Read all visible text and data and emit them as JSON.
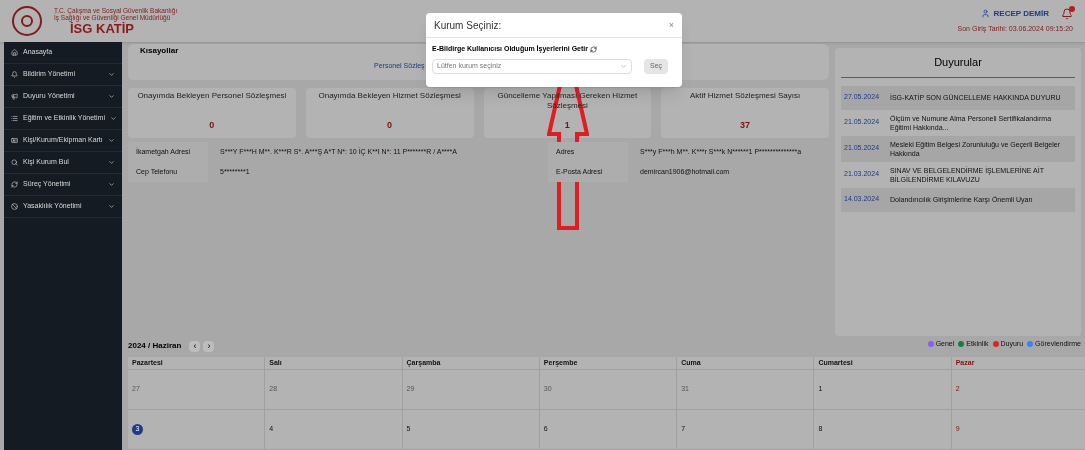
{
  "header": {
    "ministry_lines": [
      "T.C. Çalışma ve Sosyal Güvenlik Bakanlığı",
      "İş Sağlığı ve Güvenliği Genel Müdürlüğü"
    ],
    "brand": "İSG KATİP",
    "user": "RECEP DEMİR",
    "last_login": "Son Giriş Tarihi: 03.06.2024 09:15:20"
  },
  "sidebar": {
    "items": [
      {
        "label": "Anasayfa",
        "has_submenu": false
      },
      {
        "label": "Bildirim Yönetimi",
        "has_submenu": true
      },
      {
        "label": "Duyuru Yönetimi",
        "has_submenu": true
      },
      {
        "label": "Eğitim ve Etkinlik Yönetimi",
        "has_submenu": true
      },
      {
        "label": "Kişi/Kurum/Ekipman Kartı",
        "has_submenu": true
      },
      {
        "label": "Kişi Kurum Bul",
        "has_submenu": true
      },
      {
        "label": "Süreç Yönetimi",
        "has_submenu": true
      },
      {
        "label": "Yasaklılık Yönetimi",
        "has_submenu": true
      }
    ]
  },
  "shortcuts": {
    "title": "Kısayollar",
    "link": "Personel Sözleş"
  },
  "stats": [
    {
      "title": "Onayımda Bekleyen Personel Sözleşmesi",
      "value": "0"
    },
    {
      "title": "Onayımda Bekleyen Hizmet Sözleşmesi",
      "value": "0"
    },
    {
      "title": "Güncelleme Yapılması Gereken Hizmet Sözleşmesi",
      "value": "1"
    },
    {
      "title": "Aktif Hizmet Sözleşmesi Sayısı",
      "value": "37"
    }
  ],
  "profile": {
    "left": [
      {
        "label": "İkametgah Adresi",
        "value": "S***Y F***H M**. K***R S*. A***Ş A*T N*: 10 İÇ K**I N*: 11 P*******R / A****A"
      },
      {
        "label": "Cep Telefonu",
        "value": "5********1"
      }
    ],
    "right": [
      {
        "label": "Adres",
        "value": "S***y F***h M**. K***r S***k N******1 P**************a"
      },
      {
        "label": "E-Posta Adresi",
        "value": "demircan1906@hotmail.com"
      }
    ]
  },
  "calendar": {
    "title": "2024 / Haziran",
    "prev": "‹",
    "next": "›",
    "legend": [
      {
        "label": "Genel",
        "color": "#8b5cf6"
      },
      {
        "label": "Etkinlik",
        "color": "#15803d"
      },
      {
        "label": "Duyuru",
        "color": "#dc2626"
      },
      {
        "label": "Görevlendirme",
        "color": "#3b82f6"
      }
    ],
    "weekdays": [
      {
        "label": "Pazartesi",
        "holiday": false
      },
      {
        "label": "Salı",
        "holiday": false
      },
      {
        "label": "Çarşamba",
        "holiday": false
      },
      {
        "label": "Perşembe",
        "holiday": false
      },
      {
        "label": "Cuma",
        "holiday": false
      },
      {
        "label": "Cumartesi",
        "holiday": false
      },
      {
        "label": "Pazar",
        "holiday": true
      }
    ],
    "weeks": [
      [
        {
          "day": "27",
          "other_month": true,
          "today": false
        },
        {
          "day": "28",
          "other_month": true,
          "today": false
        },
        {
          "day": "29",
          "other_month": true,
          "today": false
        },
        {
          "day": "30",
          "other_month": true,
          "today": false
        },
        {
          "day": "31",
          "other_month": true,
          "today": false
        },
        {
          "day": "1",
          "other_month": false,
          "today": false
        },
        {
          "day": "2",
          "other_month": false,
          "today": false
        }
      ],
      [
        {
          "day": "3",
          "other_month": false,
          "today": true
        },
        {
          "day": "4",
          "other_month": false,
          "today": false
        },
        {
          "day": "5",
          "other_month": false,
          "today": false
        },
        {
          "day": "6",
          "other_month": false,
          "today": false
        },
        {
          "day": "7",
          "other_month": false,
          "today": false
        },
        {
          "day": "8",
          "other_month": false,
          "today": false
        },
        {
          "day": "9",
          "other_month": false,
          "today": false
        }
      ]
    ]
  },
  "announcements": {
    "title": "Duyurular",
    "items": [
      {
        "date": "27.05.2024",
        "text": "İSG-KATİP SON GÜNCELLEME HAKKINDA DUYURU"
      },
      {
        "date": "21.05.2024",
        "text": "Ölçüm ve Numune Alma Personeli Sertifikalandırma Eğitimi Hakkında..."
      },
      {
        "date": "21.05.2024",
        "text": "Mesleki Eğitim Belgesi Zorunluluğu ve Geçerli Belgeler Hakkında"
      },
      {
        "date": "21.03.2024",
        "text": "SINAV VE BELGELENDİRME İŞLEMLERİNE AİT BİLGİLENDİRME KILAVUZU"
      },
      {
        "date": "14.03.2024",
        "text": "Dolandırıcılık Girişimlerine Karşı Önemli Uyarı"
      }
    ]
  },
  "modal": {
    "title": "Kurum Seçiniz:",
    "close": "×",
    "fetch_label": "E-Bildirge Kullanıcısı Olduğum İşyerlerini Getir",
    "select_placeholder": "Lütfen kurum seçiniz",
    "button": "Seç",
    "button_disabled": true
  }
}
